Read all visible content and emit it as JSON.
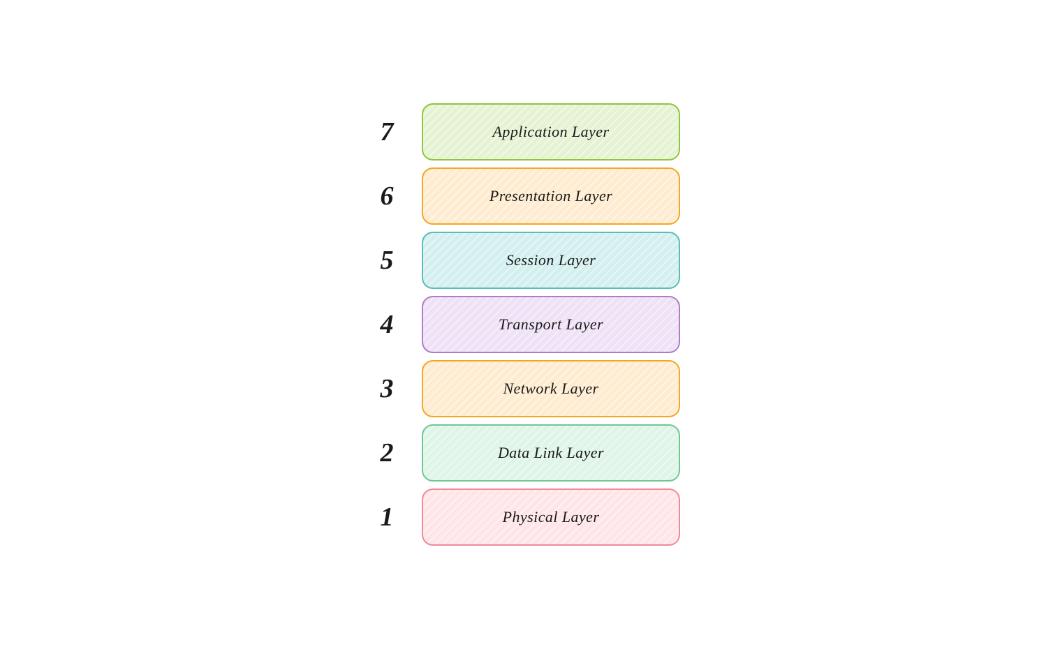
{
  "layers": [
    {
      "number": "7",
      "label": "Application Layer",
      "colorClass": "box-green"
    },
    {
      "number": "6",
      "label": "Presentation Layer",
      "colorClass": "box-orange-light"
    },
    {
      "number": "5",
      "label": "Session Layer",
      "colorClass": "box-teal"
    },
    {
      "number": "4",
      "label": "Transport Layer",
      "colorClass": "box-purple"
    },
    {
      "number": "3",
      "label": "Network Layer",
      "colorClass": "box-orange"
    },
    {
      "number": "2",
      "label": "Data Link Layer",
      "colorClass": "box-mint"
    },
    {
      "number": "1",
      "label": "Physical Layer",
      "colorClass": "box-pink"
    }
  ]
}
